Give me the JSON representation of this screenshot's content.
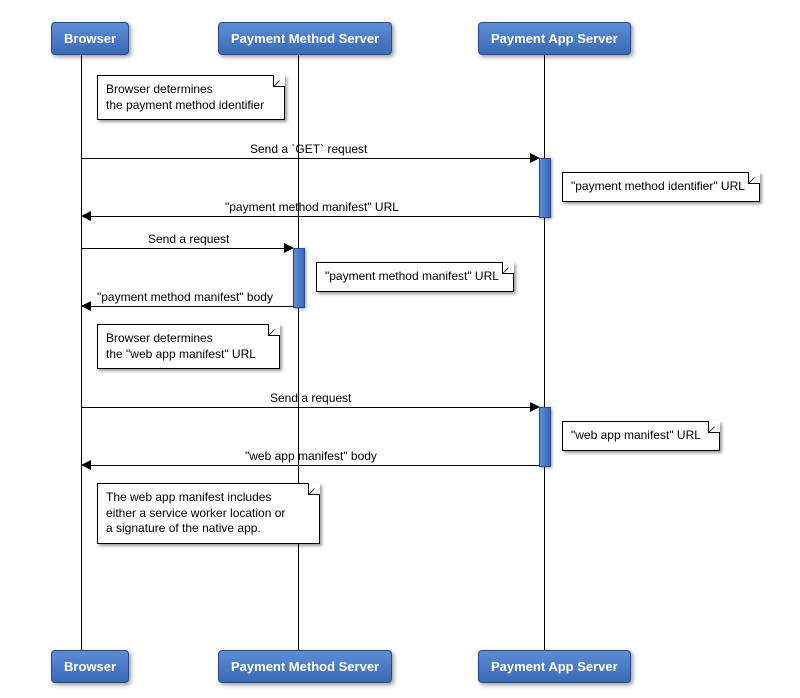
{
  "participants": {
    "browser": "Browser",
    "pms": "Payment Method Server",
    "pas": "Payment App Server"
  },
  "notes": {
    "n1_line1": "Browser determines",
    "n1_line2": "the payment method identifier",
    "n2": "\"payment method identifier\" URL",
    "n3": "\"payment method manifest\" URL",
    "n4_line1": "Browser determines",
    "n4_line2": "the \"web app manifest\" URL",
    "n5": "\"web app manifest\" URL",
    "n6_line1": "The web app manifest includes",
    "n6_line2": "either a service worker location or",
    "n6_line3": "a signature of the native app."
  },
  "messages": {
    "m1": "Send a `GET` request",
    "m2": "\"payment method manifest\" URL",
    "m3": "Send a request",
    "m4": "\"payment method manifest\" body",
    "m5": "Send a request",
    "m6": "\"web app manifest\" body"
  }
}
